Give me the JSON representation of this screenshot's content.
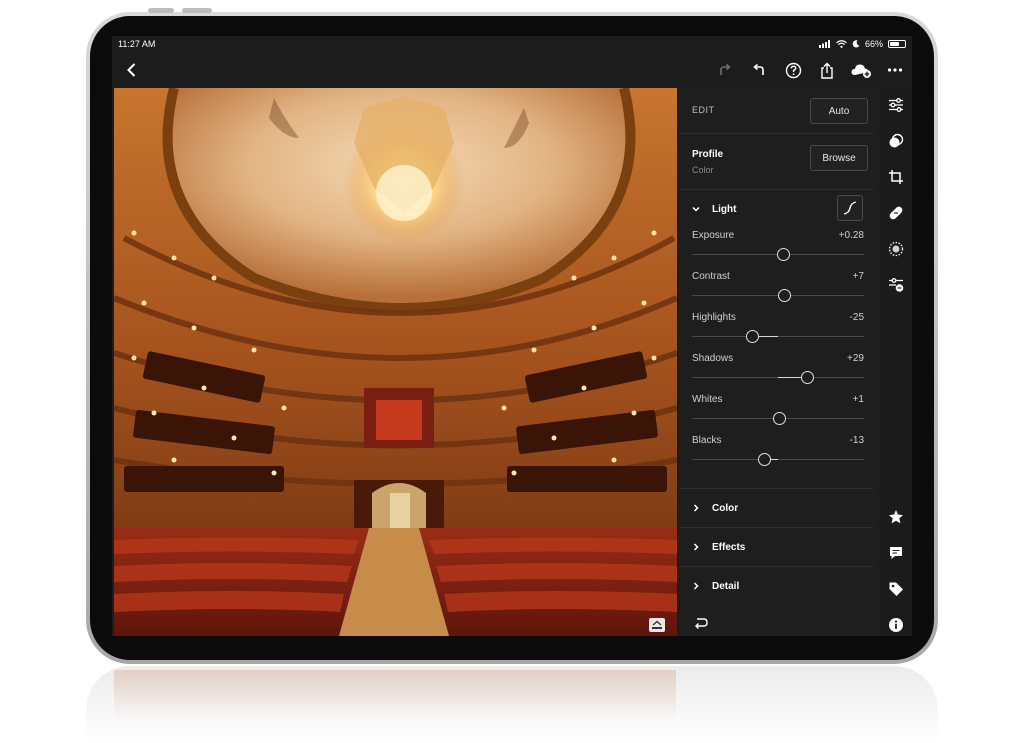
{
  "status": {
    "time": "11:27 AM",
    "battery": "66%",
    "battery_level": 0.66
  },
  "panel": {
    "edit_label": "EDIT",
    "auto_label": "Auto",
    "profile_title": "Profile",
    "profile_value": "Color",
    "browse_label": "Browse",
    "light": {
      "title": "Light",
      "sliders": [
        {
          "label": "Exposure",
          "value": "+0.28",
          "position": 0.53
        },
        {
          "label": "Contrast",
          "value": "+7",
          "position": 0.54
        },
        {
          "label": "Highlights",
          "value": "-25",
          "position": 0.35
        },
        {
          "label": "Shadows",
          "value": "+29",
          "position": 0.67
        },
        {
          "label": "Whites",
          "value": "+1",
          "position": 0.51
        },
        {
          "label": "Blacks",
          "value": "-13",
          "position": 0.42
        }
      ]
    },
    "sections": [
      "Color",
      "Effects",
      "Detail"
    ]
  },
  "toolbar": {
    "icons": [
      "redo-icon",
      "undo-icon",
      "help-icon",
      "share-icon",
      "cloud-add-icon",
      "more-icon"
    ]
  },
  "rail": {
    "icons_top": [
      "edit-sliders-icon",
      "selective-mask-icon",
      "crop-icon",
      "healing-icon",
      "optics-icon",
      "presets-icon"
    ],
    "icons_bottom": [
      "rating-star-icon",
      "comment-icon",
      "tag-icon",
      "info-icon"
    ]
  },
  "colors": {
    "accent": "#e6e6e6",
    "panel_bg": "#1e1e1e",
    "screen_bg": "#1c1c1c"
  }
}
